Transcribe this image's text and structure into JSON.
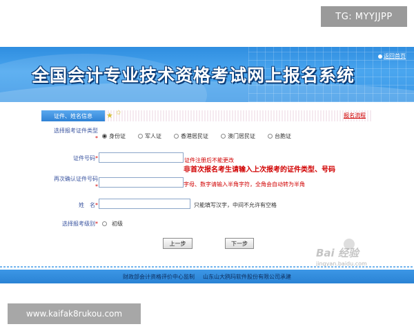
{
  "watermarks": {
    "top_tag": "TG: MYYJJPP",
    "bottom_tag": "www.kaifak8rukou.com",
    "baidu_mark": "Bai 经验",
    "baidu_url": "jingyan.baidu.com"
  },
  "banner": {
    "title": "全国会计专业技术资格考试网上报名系统",
    "back_link": "返回首页"
  },
  "tabs": {
    "active_tab": "证件、姓名信息",
    "flow_link": "报名流程"
  },
  "form": {
    "required_mark": "*",
    "id_type_label": "选择报考证件类型",
    "id_types": [
      {
        "label": "身份证",
        "selected": true
      },
      {
        "label": "军人证",
        "selected": false
      },
      {
        "label": "香港居民证",
        "selected": false
      },
      {
        "label": "澳门居民证",
        "selected": false
      },
      {
        "label": "台胞证",
        "selected": false
      }
    ],
    "id_number_label": "证件号码",
    "id_number_value": "",
    "id_hint_small": "证件注册后不能更改",
    "id_hint_big": "非首次报名考生请输入上次报考的证件类型、号码",
    "confirm_label": "再次确认证件号码",
    "confirm_value": "",
    "confirm_hint": "字母、数字请输入半角字符，全角会自动转为半角",
    "name_label": "姓　名",
    "name_value": "",
    "name_hint": "只能填写汉字，中间不允许有空格",
    "level_label": "选择报考级别",
    "level_option": "初级",
    "prev_button": "上一步",
    "next_button": "下一步"
  },
  "footer": {
    "left": "财政部会计资格评价中心监制",
    "right": "山东山大鸥玛软件股份有限公司承建"
  },
  "colors": {
    "banner_blue": "#3a97e6",
    "label_blue": "#3b55a0",
    "required_red": "#d10000"
  }
}
